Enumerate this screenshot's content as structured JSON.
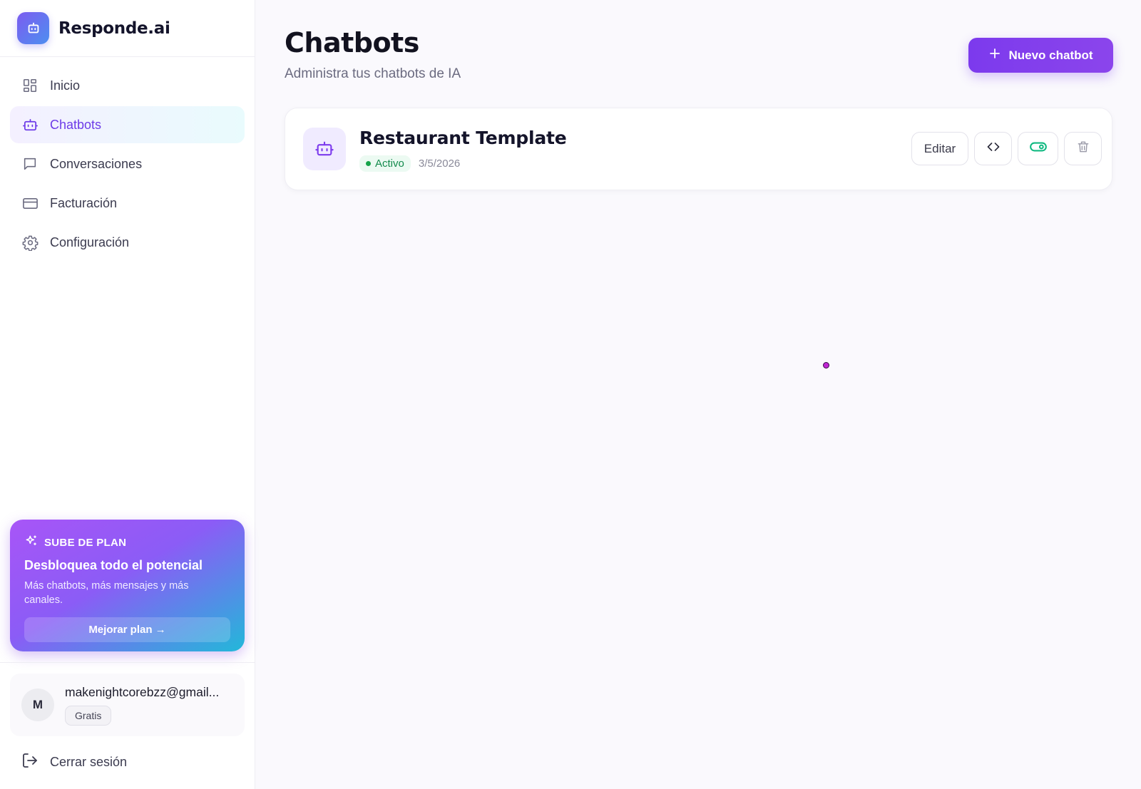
{
  "brand": {
    "name": "Responde.ai",
    "icon": "bot-icon"
  },
  "nav": {
    "items": [
      {
        "label": "Inicio",
        "icon": "grid-icon",
        "active": false
      },
      {
        "label": "Chatbots",
        "icon": "bot-icon",
        "active": true
      },
      {
        "label": "Conversaciones",
        "icon": "message-icon",
        "active": false
      },
      {
        "label": "Facturación",
        "icon": "credit-card-icon",
        "active": false
      },
      {
        "label": "Configuración",
        "icon": "gear-icon",
        "active": false
      }
    ]
  },
  "promo": {
    "eyebrow": "SUBE DE PLAN",
    "title": "Desbloquea todo el potencial",
    "description": "Más chatbots, más mensajes y más canales.",
    "button_label": "Mejorar plan →"
  },
  "user": {
    "initial": "M",
    "email": "makenightcorebzz@gmail...",
    "plan": "Gratis"
  },
  "logout_label": "Cerrar sesión",
  "header": {
    "title": "Chatbots",
    "subtitle": "Administra tus chatbots de IA",
    "new_button_label": "Nuevo chatbot"
  },
  "chatbots": [
    {
      "name": "Restaurant Template",
      "status": "Activo",
      "date": "3/5/2026",
      "edit_label": "Editar",
      "enabled": true
    }
  ],
  "colors": {
    "accent": "#7c3aed",
    "active_status": "#16a34a",
    "promo_start": "#a855f7",
    "promo_end": "#22b8d9"
  }
}
